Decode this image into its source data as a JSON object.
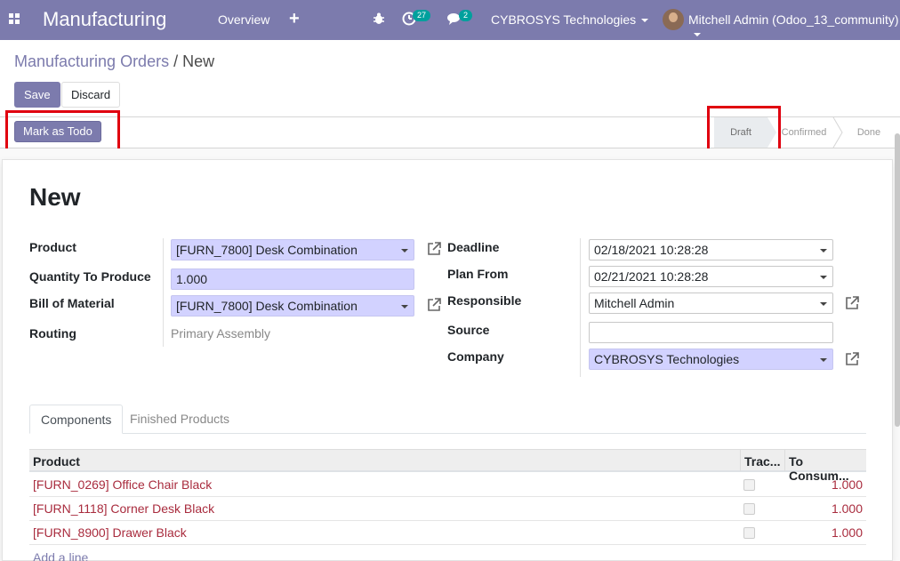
{
  "navbar": {
    "brand": "Manufacturing",
    "overview": "Overview",
    "plus": "+",
    "activity_count": "27",
    "messages_count": "2",
    "company": "CYBROSYS Technologies",
    "user": "Mitchell Admin (Odoo_13_community)"
  },
  "breadcrumb": {
    "parent": "Manufacturing Orders",
    "sep": " / ",
    "current": "New"
  },
  "buttons": {
    "save": "Save",
    "discard": "Discard",
    "mark_todo": "Mark as Todo"
  },
  "stages": {
    "draft": "Draft",
    "confirmed": "Confirmed",
    "done": "Done"
  },
  "form": {
    "title": "New",
    "labels": {
      "product": "Product",
      "quantity": "Quantity To Produce",
      "bom": "Bill of Material",
      "routing": "Routing",
      "deadline": "Deadline",
      "plan_from": "Plan From",
      "responsible": "Responsible",
      "source": "Source",
      "company": "Company"
    },
    "values": {
      "product": "[FURN_7800] Desk Combination",
      "quantity": "1.000",
      "bom": "[FURN_7800] Desk Combination",
      "routing": "Primary Assembly",
      "deadline": "02/18/2021 10:28:28",
      "plan_from": "02/21/2021 10:28:28",
      "responsible": "Mitchell Admin",
      "source": "",
      "company": "CYBROSYS Technologies"
    }
  },
  "tabs": {
    "components": "Components",
    "finished": "Finished Products"
  },
  "table": {
    "headers": {
      "product": "Product",
      "tracking": "Trac...",
      "to_consume": "To Consum..."
    },
    "rows": [
      {
        "product": "[FURN_0269] Office Chair Black",
        "qty": "1.000"
      },
      {
        "product": "[FURN_1118] Corner Desk Black",
        "qty": "1.000"
      },
      {
        "product": "[FURN_8900] Drawer Black",
        "qty": "1.000"
      }
    ],
    "add_line": "Add a line"
  },
  "colors": {
    "brand": "#7c7bad",
    "highlight": "#e0000f",
    "link": "#a92c3e",
    "required_field": "#d2d2ff"
  },
  "icons": [
    "apps-icon",
    "bug-icon",
    "activity-icon",
    "chat-icon",
    "external-link-icon",
    "dropdown-icon"
  ]
}
